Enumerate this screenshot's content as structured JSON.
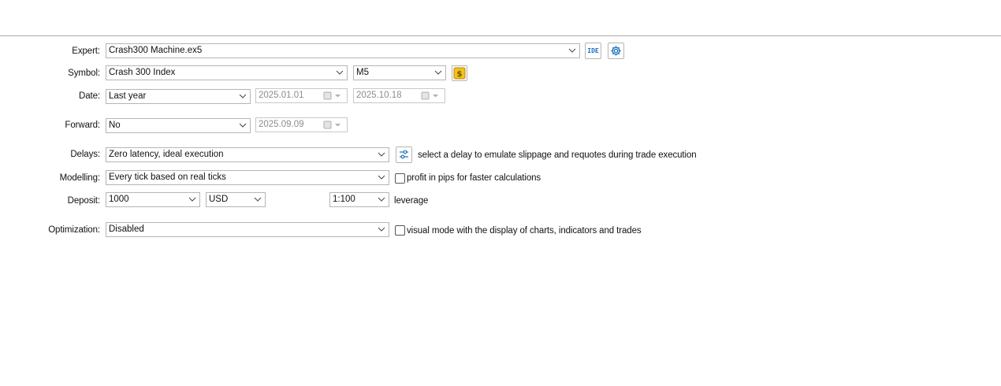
{
  "form": {
    "expert": {
      "label": "Expert:",
      "value": "Crash300 Machine.ex5",
      "ide_button": "IDE"
    },
    "symbol": {
      "label": "Symbol:",
      "value": "Crash 300 Index",
      "timeframe": "M5"
    },
    "date": {
      "label": "Date:",
      "value": "Last year",
      "from": "2025.01.01",
      "to": "2025.10.18"
    },
    "forward": {
      "label": "Forward:",
      "value": "No",
      "date": "2025.09.09"
    },
    "delays": {
      "label": "Delays:",
      "value": "Zero latency, ideal execution",
      "hint": "select a delay to emulate slippage and requotes during trade execution"
    },
    "modelling": {
      "label": "Modelling:",
      "value": "Every tick based on real ticks",
      "checkbox_label": "profit in pips for faster calculations"
    },
    "deposit": {
      "label": "Deposit:",
      "value": "1000",
      "currency": "USD",
      "leverage": "1:100",
      "leverage_label": "leverage"
    },
    "optimization": {
      "label": "Optimization:",
      "value": "Disabled",
      "checkbox_label": "visual mode with the display of charts, indicators and trades"
    }
  },
  "colors": {
    "accent": "#1e73be",
    "coin": "#f0c419",
    "border": "#b5b5b5"
  }
}
